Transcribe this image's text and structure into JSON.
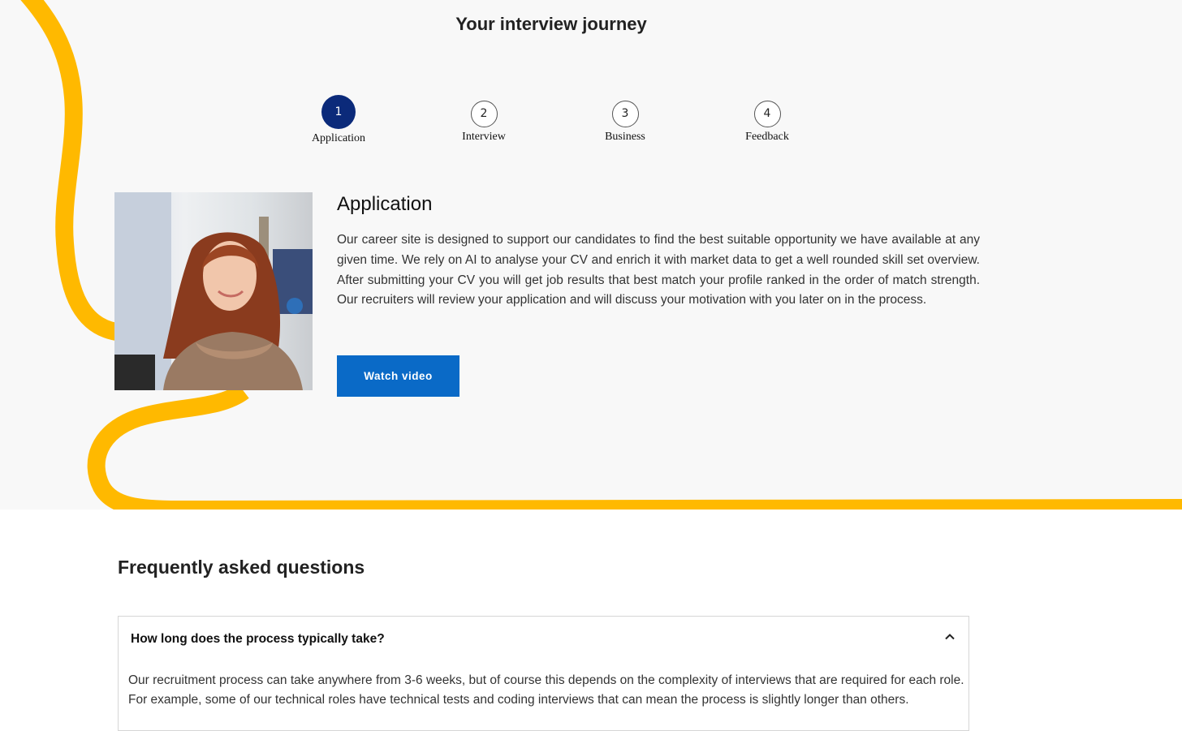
{
  "journey": {
    "title": "Your interview journey",
    "steps": [
      {
        "number": "1",
        "label": "Application",
        "active": true
      },
      {
        "number": "2",
        "label": "Interview",
        "active": false
      },
      {
        "number": "3",
        "label": "Business",
        "active": false
      },
      {
        "number": "4",
        "label": "Feedback",
        "active": false
      }
    ],
    "content": {
      "heading": "Application",
      "body": "Our career site is designed to support our candidates to find the best suitable opportunity we have available at any given time. We rely on AI to analyse your CV and enrich it with market data to get a well rounded skill set overview. After submitting your CV you will get job results that best match your profile ranked in the order of match strength. Our recruiters will review your application and will discuss your motivation with you later on in the process.",
      "button_label": "Watch video"
    }
  },
  "faq": {
    "title": "Frequently asked questions",
    "items": [
      {
        "question": "How long does the process typically take?",
        "answer": "Our recruitment process can take anywhere from 3-6 weeks, but of course this depends on the complexity of interviews that are required for each role. For example, some of our technical roles have technical tests and coding interviews that can mean the process is slightly longer than others.",
        "expanded": true
      }
    ]
  },
  "colors": {
    "accent_yellow": "#ffb900",
    "active_step": "#0b2a7a",
    "button_blue": "#0a6ac7",
    "section_background": "#f8f8f8"
  },
  "icons": {
    "faq_toggle": "chevron-up-icon"
  }
}
